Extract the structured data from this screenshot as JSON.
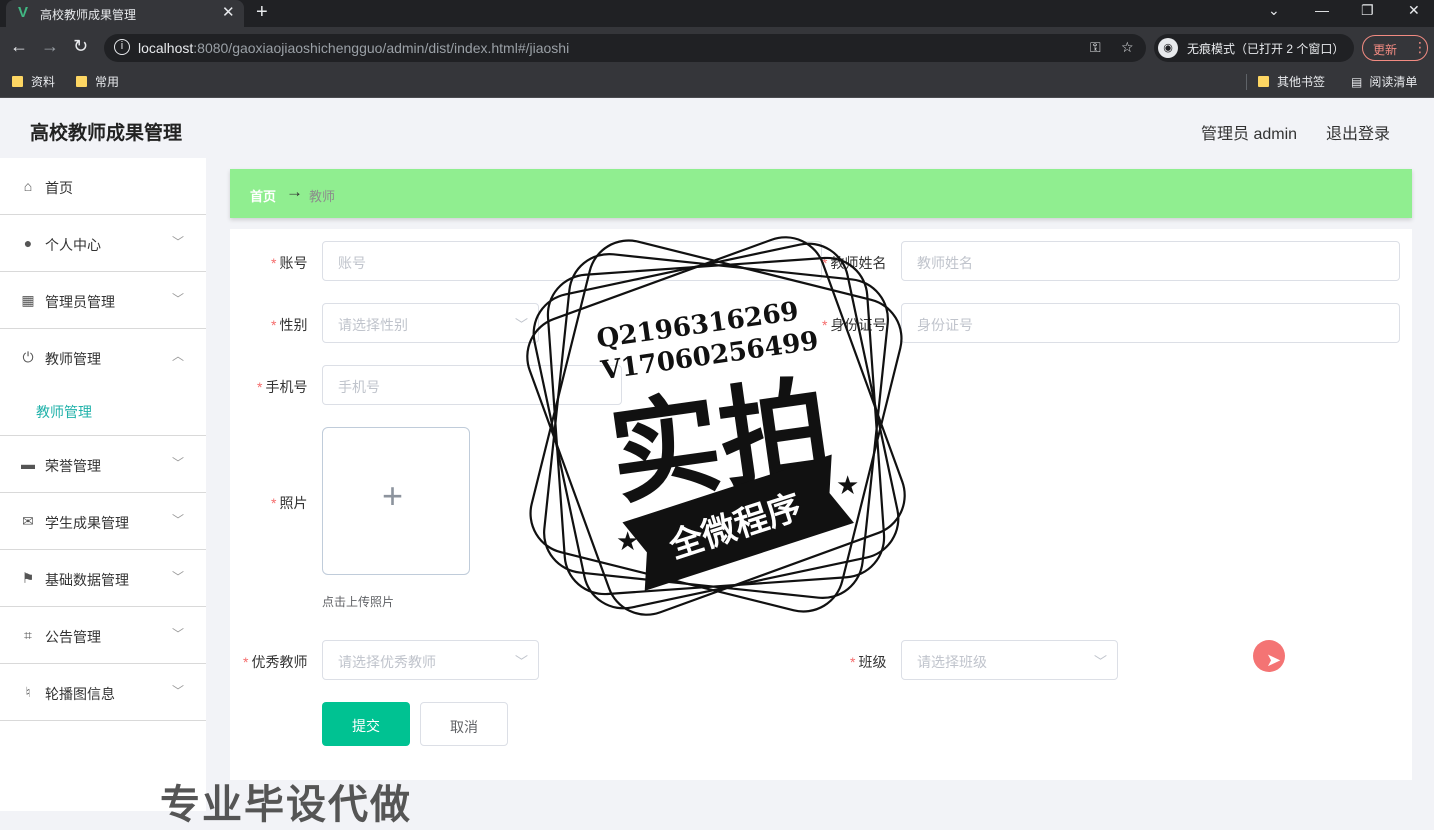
{
  "browser": {
    "tab_title": "高校教师成果管理",
    "url_host": "localhost",
    "url_rest": ":8080/gaoxiaojiaoshichengguo/admin/dist/index.html#/jiaoshi",
    "incognito_label": "无痕模式（已打开 2 个窗口）",
    "update_label": "更新",
    "bookmarks": [
      "资料",
      "常用",
      "其他书签",
      "阅读清单"
    ]
  },
  "header": {
    "title": "高校教师成果管理",
    "user_label": "管理员 admin",
    "logout_label": "退出登录"
  },
  "sidebar": {
    "items": [
      {
        "label": "首页",
        "icon": "home-icon"
      },
      {
        "label": "个人中心",
        "icon": "user-icon"
      },
      {
        "label": "管理员管理",
        "icon": "grid-icon"
      },
      {
        "label": "教师管理",
        "icon": "power-icon",
        "expanded": true,
        "children": [
          "教师管理"
        ]
      },
      {
        "label": "荣誉管理",
        "icon": "stamp-icon"
      },
      {
        "label": "学生成果管理",
        "icon": "mail-icon"
      },
      {
        "label": "基础数据管理",
        "icon": "flag-icon"
      },
      {
        "label": "公告管理",
        "icon": "crop-icon"
      },
      {
        "label": "轮播图信息",
        "icon": "bell-off-icon"
      }
    ]
  },
  "breadcrumb": {
    "home": "首页",
    "arrow": "→",
    "current": "教师"
  },
  "form": {
    "account": {
      "label": "账号",
      "placeholder": "账号"
    },
    "teacher_name": {
      "label": "教师姓名",
      "placeholder": "教师姓名"
    },
    "gender": {
      "label": "性别",
      "placeholder": "请选择性别"
    },
    "id_number": {
      "label": "身份证号",
      "placeholder": "身份证号"
    },
    "phone": {
      "label": "手机号",
      "placeholder": "手机号"
    },
    "photo": {
      "label": "照片",
      "tip": "点击上传照片"
    },
    "excellent": {
      "label": "优秀教师",
      "placeholder": "请选择优秀教师"
    },
    "class": {
      "label": "班级",
      "placeholder": "请选择班级"
    },
    "submit_label": "提交",
    "cancel_label": "取消"
  },
  "watermark": {
    "line1": "Q2196316269",
    "line2": "V17060256499",
    "main": "实拍",
    "banner": "全微程序",
    "bottom": "专业毕设代做"
  },
  "colors": {
    "accent": "#00c292",
    "breadcrumb_bg": "#90ee90",
    "submenu_active": "#20b2aa",
    "required": "#f56c6c"
  }
}
